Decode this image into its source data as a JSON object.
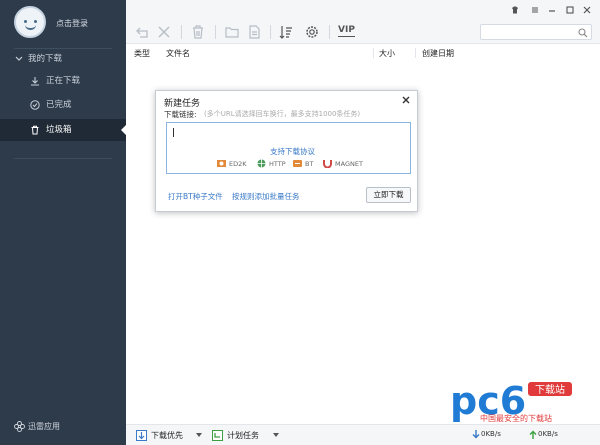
{
  "sidebar": {
    "login_label": "点击登录",
    "group_label": "我的下载",
    "items": [
      {
        "label": "正在下载",
        "icon": "download-icon"
      },
      {
        "label": "已完成",
        "icon": "check-circle-icon"
      },
      {
        "label": "垃圾箱",
        "icon": "trash-icon"
      }
    ],
    "bottom_label": "迅雷应用"
  },
  "toolbar": {
    "vip_label": "VIP"
  },
  "columns": [
    "类型",
    "文件名",
    "大小",
    "创建日期"
  ],
  "dialog": {
    "title": "新建任务",
    "field_label": "下载链接:",
    "hint": "(多个URL请选择回车换行，最多支持1000条任务)",
    "protocol_title": "支持下载协议",
    "protocols": [
      "ED2K",
      "HTTP",
      "BT",
      "MAGNET"
    ],
    "link_bt": "打开BT种子文件",
    "link_batch": "按规则添加批量任务",
    "download_button": "立即下载"
  },
  "bottombar": {
    "priority_label": "下载优先",
    "schedule_label": "计划任务",
    "down_speed": "0KB/s",
    "up_speed": "0KB/s"
  },
  "watermark": {
    "brand": "pc6",
    "badge": "下载站",
    "tagline": "中国最安全的下载站"
  },
  "colors": {
    "sidebar_bg": "#2e3b4a",
    "accent": "#3a7ac8",
    "watermark_blue": "#1f7bd4",
    "watermark_red": "#e03a3a"
  }
}
